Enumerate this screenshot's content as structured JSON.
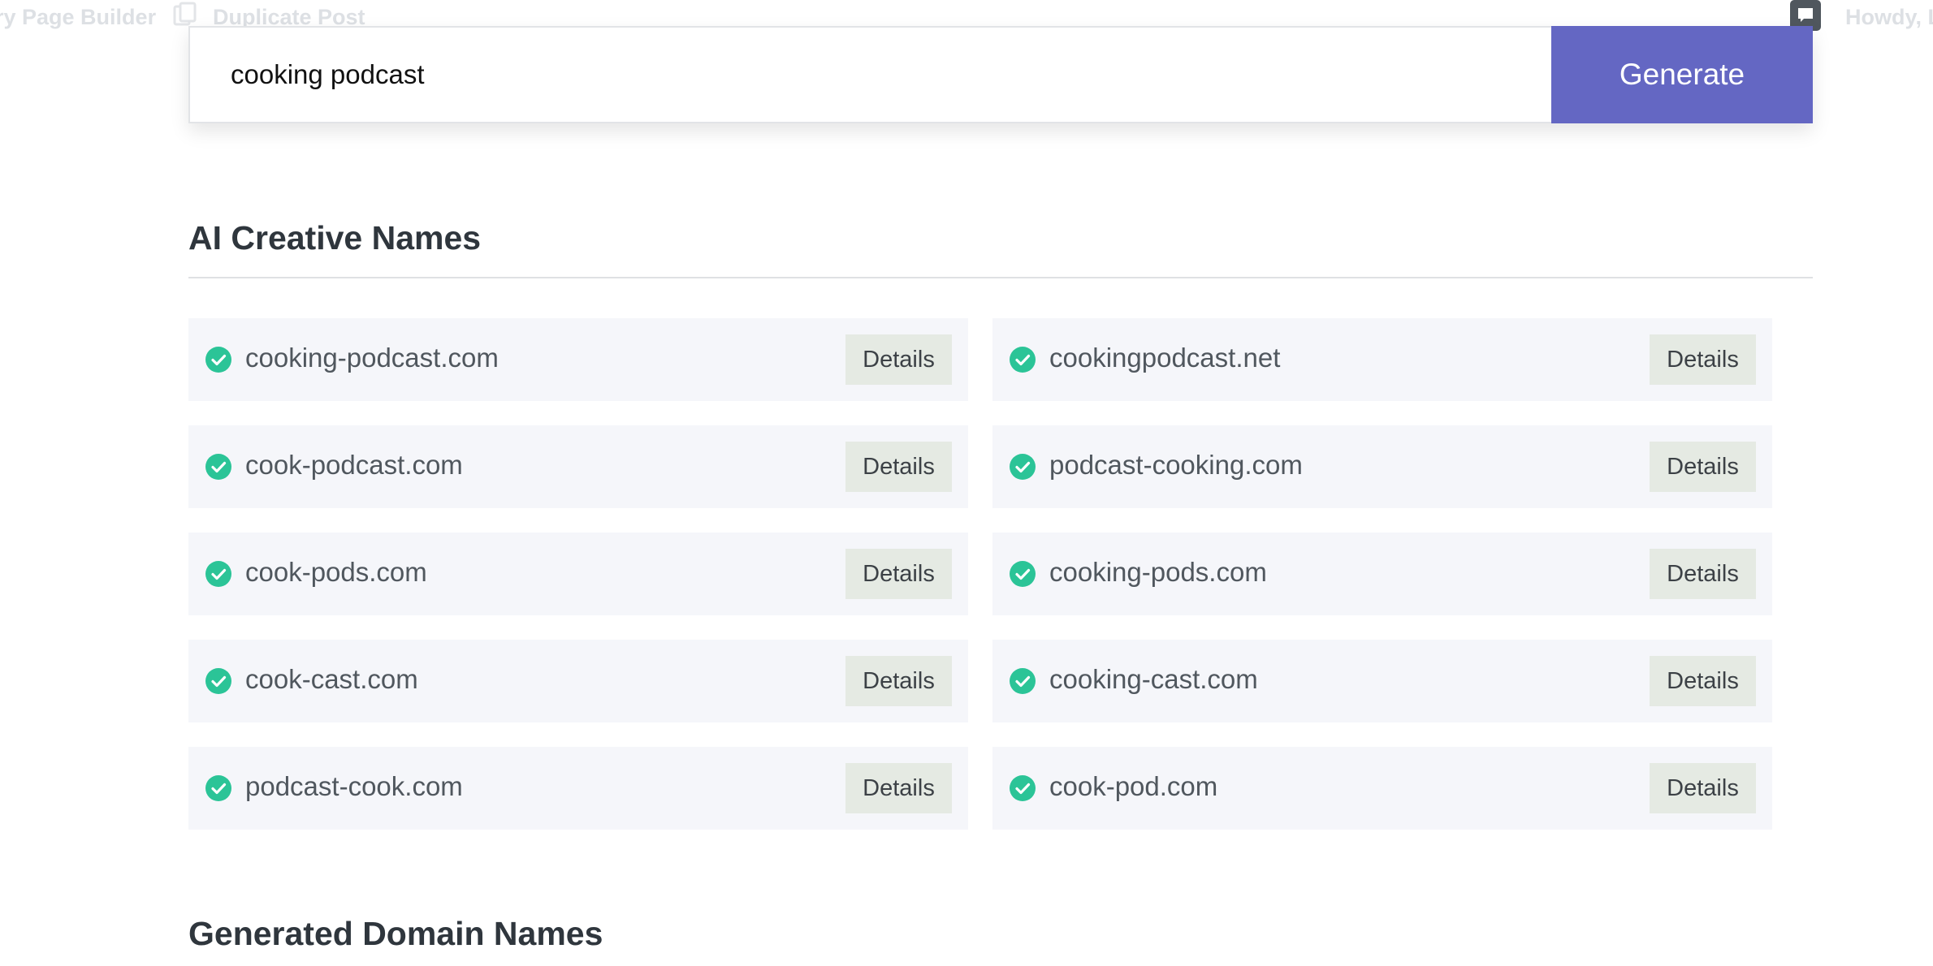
{
  "adminbar": {
    "builder_label": "ry Page Builder",
    "duplicate_label": "Duplicate Post",
    "howdy_label": "Howdy, L"
  },
  "search": {
    "value": "cooking podcast",
    "generate_label": "Generate"
  },
  "ai_section": {
    "title": "AI Creative Names",
    "details_label": "Details",
    "results": [
      {
        "domain": "cooking-podcast.com",
        "available": true
      },
      {
        "domain": "cookingpodcast.net",
        "available": true
      },
      {
        "domain": "cook-podcast.com",
        "available": true
      },
      {
        "domain": "podcast-cooking.com",
        "available": true
      },
      {
        "domain": "cook-pods.com",
        "available": true
      },
      {
        "domain": "cooking-pods.com",
        "available": true
      },
      {
        "domain": "cook-cast.com",
        "available": true
      },
      {
        "domain": "cooking-cast.com",
        "available": true
      },
      {
        "domain": "podcast-cook.com",
        "available": true
      },
      {
        "domain": "cook-pod.com",
        "available": true
      }
    ]
  },
  "generated_section": {
    "title": "Generated Domain Names"
  },
  "colors": {
    "accent": "#6467c3",
    "available": "#2bc497",
    "card_bg": "#f5f6fa",
    "details_bg": "#e5eae3"
  },
  "icons": {
    "available": "check-circle-icon",
    "duplicate": "duplicate-icon",
    "comment": "comment-icon"
  }
}
